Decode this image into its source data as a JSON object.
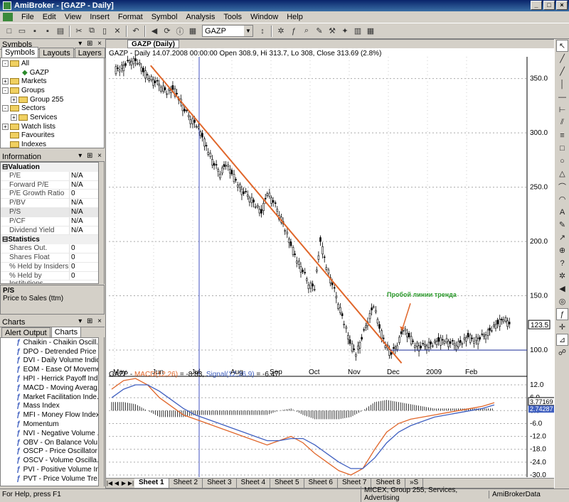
{
  "window": {
    "title": "AmiBroker - [GAZP - Daily]",
    "minimize": "_",
    "maximize": "□",
    "close": "×"
  },
  "menu": [
    "File",
    "Edit",
    "View",
    "Insert",
    "Format",
    "Symbol",
    "Analysis",
    "Tools",
    "Window",
    "Help"
  ],
  "toolbar": {
    "symbol": "GAZP"
  },
  "symbols_panel": {
    "title": "Symbols",
    "tabs": [
      "Symbols",
      "Layouts",
      "Layers"
    ],
    "tree": [
      {
        "label": "All",
        "level": 0,
        "expander": "-"
      },
      {
        "label": "GAZP",
        "level": 2,
        "expander": ""
      },
      {
        "label": "Markets",
        "level": 0,
        "expander": "+"
      },
      {
        "label": "Groups",
        "level": 0,
        "expander": "-"
      },
      {
        "label": "Group 255",
        "level": 1,
        "expander": "+"
      },
      {
        "label": "Sectors",
        "level": 0,
        "expander": "-"
      },
      {
        "label": "Services",
        "level": 1,
        "expander": "+"
      },
      {
        "label": "Watch lists",
        "level": 0,
        "expander": "+"
      },
      {
        "label": "Favourites",
        "level": 0,
        "expander": ""
      },
      {
        "label": "Indexes",
        "level": 0,
        "expander": ""
      }
    ]
  },
  "information_panel": {
    "title": "Information",
    "sections": [
      {
        "name": "Valuation",
        "rows": [
          {
            "k": "P/E",
            "v": "N/A"
          },
          {
            "k": "Forward P/E",
            "v": "N/A"
          },
          {
            "k": "P/E Growth Ratio",
            "v": "0"
          },
          {
            "k": "P/BV",
            "v": "N/A"
          },
          {
            "k": "P/S",
            "v": "N/A"
          },
          {
            "k": "P/CF",
            "v": "N/A"
          },
          {
            "k": "Dividend Yield",
            "v": "N/A"
          }
        ]
      },
      {
        "name": "Statistics",
        "rows": [
          {
            "k": "Shares Out.",
            "v": "0"
          },
          {
            "k": "Shares Float",
            "v": "0"
          },
          {
            "k": "% Held by Insiders",
            "v": "0"
          },
          {
            "k": "% Held by Institutions",
            "v": "0"
          }
        ]
      }
    ],
    "desc_title": "P/S",
    "desc_text": "Price to Sales (ttm)"
  },
  "charts_panel": {
    "title": "Charts",
    "tabs": [
      "Alert Output",
      "Charts"
    ],
    "items": [
      "Chaikin - Chaikin Oscill...",
      "DPO - Detrended Price O...",
      "DVI - Daily Volume Indic...",
      "EOM - Ease Of Moveme...",
      "HPI - Herrick Payoff Ind...",
      "MACD - Moving Averag...",
      "Market Facilitation Inde...",
      "Mass Index",
      "MFI - Money Flow Index",
      "Momentum",
      "NVI - Negative Volume ...",
      "OBV - On Balance Volu...",
      "OSCP - Price Oscillator",
      "OSCV - Volume Oscilla...",
      "PVI - Positive Volume In...",
      "PVT - Price Volume Tre..."
    ]
  },
  "document": {
    "tab": "GAZP (Daily)"
  },
  "chart_data": [
    {
      "type": "candlestick",
      "header": "GAZP - Daily 14.07.2008 00:00:00 Open 308.9, Hi 313.7, Lo 308, Close 313.69 (2.8%)",
      "months": [
        "May",
        "Jun",
        "Jul",
        "Aug",
        "Sep",
        "Oct",
        "Nov",
        "Dec",
        "2009",
        "Feb"
      ],
      "y_ticks": [
        "350.0",
        "300.0",
        "250.0",
        "200.0",
        "150.0",
        "100.0"
      ],
      "ylim": [
        85,
        370
      ],
      "last_price": "123.5",
      "annotation": "Пробой линии тренда",
      "close_path": [
        358,
        362,
        366,
        364,
        356,
        350,
        346,
        342,
        336,
        340,
        332,
        320,
        312,
        306,
        296,
        282,
        270,
        262,
        270,
        262,
        252,
        244,
        240,
        232,
        226,
        244,
        236,
        224,
        210,
        196,
        182,
        172,
        160,
        156,
        200,
        176,
        160,
        142,
        124,
        106,
        96,
        110,
        126,
        140,
        120,
        104,
        96,
        104,
        118,
        112,
        104,
        102,
        104,
        104,
        108,
        108,
        106,
        104,
        106,
        112,
        108,
        110,
        114,
        118,
        124,
        128,
        124
      ],
      "trendline": {
        "from": [
          0.1,
          362
        ],
        "to": [
          0.7,
          88
        ]
      },
      "support_level": 100,
      "orange_color": "#e0662a"
    },
    {
      "type": "line",
      "header": "GAZP - MACD(12,26) = -8.83, Signal(12,26,9) = -6.47",
      "series": [
        {
          "name": "MACD(12,26)",
          "color": "#e0662a",
          "values": [
            10,
            14,
            15,
            12,
            6,
            2,
            -2,
            -4,
            -6,
            -8,
            -10,
            -12,
            -14,
            -16,
            -14,
            -12,
            -15,
            -20,
            -24,
            -28,
            -30,
            -27,
            -18,
            -10,
            -6,
            -4,
            -3,
            -2,
            -1,
            0,
            1,
            2,
            3.7
          ]
        },
        {
          "name": "Signal(12,26,9)",
          "color": "#4060c0",
          "values": [
            6,
            10,
            12,
            12,
            9,
            5,
            1,
            -2,
            -4,
            -6,
            -8,
            -10,
            -12,
            -14,
            -14,
            -13,
            -13,
            -16,
            -20,
            -24,
            -27,
            -27,
            -22,
            -15,
            -10,
            -7,
            -5,
            -3,
            -2,
            -1,
            0,
            1,
            2.7
          ]
        }
      ],
      "y_ticks": [
        "12.0",
        "6.0",
        "0.0",
        "-6.0",
        "-12.0",
        "-18.0",
        "-24.0",
        "-30.0"
      ],
      "ylim": [
        -31,
        14
      ],
      "last_macd": "3.77169",
      "last_signal": "2.74287"
    }
  ],
  "sheets": [
    "Sheet 1",
    "Sheet 2",
    "Sheet 3",
    "Sheet 4",
    "Sheet 5",
    "Sheet 6",
    "Sheet 7",
    "Sheet 8",
    "»S"
  ],
  "status": {
    "help": "For Help, press F1",
    "info": "MICEX, Group 255, Services, Advertising",
    "source": "AmiBrokerData"
  }
}
